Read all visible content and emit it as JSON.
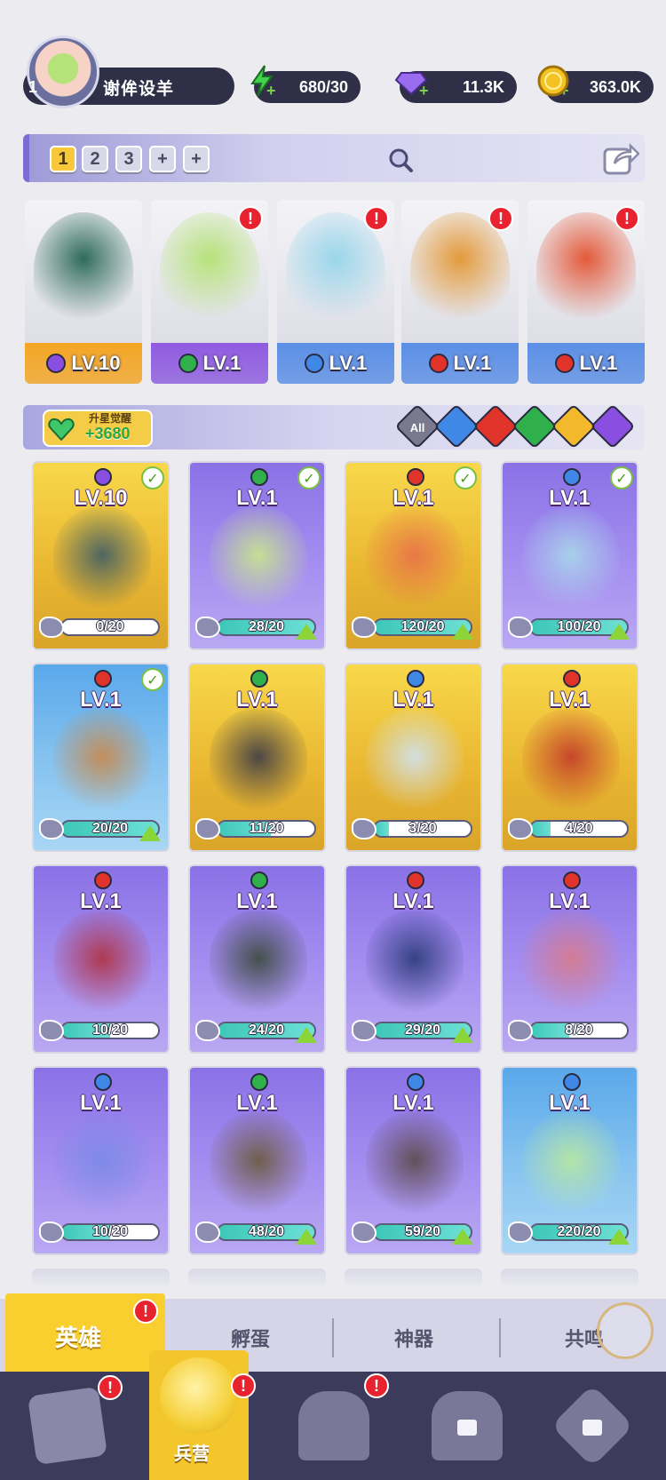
{
  "player": {
    "level": "1",
    "name": "谢侔设羊"
  },
  "resources": [
    {
      "name": "stamina",
      "value": "680/30",
      "icon": "lightning-icon",
      "color": "#3fd24a"
    },
    {
      "name": "gems",
      "value": "11.3K",
      "icon": "gem-icon",
      "color": "#9a6cf0"
    },
    {
      "name": "gold",
      "value": "363.0K",
      "icon": "coin-icon",
      "color": "#f4c322"
    }
  ],
  "team": {
    "slots": [
      "1",
      "2",
      "3",
      "+",
      "+"
    ],
    "active_slot": "1",
    "members": [
      {
        "level": "LV.10",
        "element": "dark",
        "bar_color": "#f4a623",
        "art": "#2f6b5a",
        "alert": false
      },
      {
        "level": "LV.1",
        "element": "wind",
        "bar_color": "#8f5be0",
        "art": "#b6e27a",
        "alert": true
      },
      {
        "level": "LV.1",
        "element": "water",
        "bar_color": "#5b8fe6",
        "art": "#9ad6ea",
        "alert": true
      },
      {
        "level": "LV.1",
        "element": "fire",
        "bar_color": "#5b8fe6",
        "art": "#e39a3a",
        "alert": true
      },
      {
        "level": "LV.1",
        "element": "fire",
        "bar_color": "#5b8fe6",
        "art": "#e35a3a",
        "alert": true
      }
    ]
  },
  "star_awaken": {
    "title": "升星觉醒",
    "value": "+3680"
  },
  "filters": [
    {
      "name": "all",
      "label": "All",
      "color": "#7a7a8e"
    },
    {
      "name": "water",
      "color": "#3f88e6"
    },
    {
      "name": "fire",
      "color": "#e0342a"
    },
    {
      "name": "wind",
      "color": "#2fb04a"
    },
    {
      "name": "light",
      "color": "#f2b92c"
    },
    {
      "name": "dark",
      "color": "#8a4fe0"
    }
  ],
  "element_colors": {
    "dark": "#8a4fe0",
    "wind": "#2fb04a",
    "water": "#3f88e6",
    "fire": "#e0342a",
    "light": "#f2b92c"
  },
  "heroes": [
    {
      "level": "LV.10",
      "element": "dark",
      "progress": "0/20",
      "fraction": 0.0,
      "rarity": "gold",
      "check": true,
      "upgrade": false,
      "art": "#3d5c66"
    },
    {
      "level": "LV.1",
      "element": "wind",
      "progress": "28/20",
      "fraction": 1.0,
      "rarity": "purple",
      "check": true,
      "upgrade": true,
      "art": "#c9e88a"
    },
    {
      "level": "LV.1",
      "element": "fire",
      "progress": "120/20",
      "fraction": 1.0,
      "rarity": "gold",
      "check": true,
      "upgrade": true,
      "art": "#e8704a"
    },
    {
      "level": "LV.1",
      "element": "water",
      "progress": "100/20",
      "fraction": 1.0,
      "rarity": "purple",
      "check": true,
      "upgrade": true,
      "art": "#a8d8ea"
    },
    {
      "level": "LV.1",
      "element": "fire",
      "progress": "20/20",
      "fraction": 1.0,
      "rarity": "blue",
      "check": true,
      "upgrade": true,
      "art": "#c8884a"
    },
    {
      "level": "LV.1",
      "element": "wind",
      "progress": "11/20",
      "fraction": 0.55,
      "rarity": "gold",
      "check": false,
      "upgrade": false,
      "art": "#3a3a48"
    },
    {
      "level": "LV.1",
      "element": "water",
      "progress": "3/20",
      "fraction": 0.15,
      "rarity": "gold",
      "check": false,
      "upgrade": false,
      "art": "#cfe2f2"
    },
    {
      "level": "LV.1",
      "element": "fire",
      "progress": "4/20",
      "fraction": 0.2,
      "rarity": "gold",
      "check": false,
      "upgrade": false,
      "art": "#c23a2a"
    },
    {
      "level": "LV.1",
      "element": "fire",
      "progress": "10/20",
      "fraction": 0.5,
      "rarity": "purple",
      "check": false,
      "upgrade": false,
      "art": "#b03040"
    },
    {
      "level": "LV.1",
      "element": "wind",
      "progress": "24/20",
      "fraction": 1.0,
      "rarity": "purple",
      "check": false,
      "upgrade": true,
      "art": "#3a4a3a"
    },
    {
      "level": "LV.1",
      "element": "fire",
      "progress": "29/20",
      "fraction": 1.0,
      "rarity": "purple",
      "check": false,
      "upgrade": true,
      "art": "#2a3a78"
    },
    {
      "level": "LV.1",
      "element": "fire",
      "progress": "8/20",
      "fraction": 0.4,
      "rarity": "purple",
      "check": false,
      "upgrade": false,
      "art": "#d87a8a"
    },
    {
      "level": "LV.1",
      "element": "water",
      "progress": "10/20",
      "fraction": 0.5,
      "rarity": "purple",
      "check": false,
      "upgrade": false,
      "art": "#7a8ae6"
    },
    {
      "level": "LV.1",
      "element": "wind",
      "progress": "48/20",
      "fraction": 1.0,
      "rarity": "purple",
      "check": false,
      "upgrade": true,
      "art": "#6a5a3a"
    },
    {
      "level": "LV.1",
      "element": "water",
      "progress": "59/20",
      "fraction": 1.0,
      "rarity": "purple",
      "check": false,
      "upgrade": true,
      "art": "#5a4a4a"
    },
    {
      "level": "LV.1",
      "element": "water",
      "progress": "220/20",
      "fraction": 1.0,
      "rarity": "blue",
      "check": false,
      "upgrade": true,
      "art": "#b8e8a0"
    }
  ],
  "sub_tabs": [
    {
      "label": "英雄",
      "active": true,
      "alert": true
    },
    {
      "label": "孵蛋",
      "active": false,
      "alert": false
    },
    {
      "label": "神器",
      "active": false,
      "alert": false
    },
    {
      "label": "共鸣",
      "active": false,
      "alert": false
    }
  ],
  "bottom_nav": [
    {
      "name": "cards",
      "icon": "cards-icon",
      "alert": true,
      "locked": false
    },
    {
      "name": "barracks",
      "label": "兵营",
      "icon": "fist-icon",
      "alert": true,
      "locked": false,
      "active": true
    },
    {
      "name": "map",
      "icon": "map-book-icon",
      "alert": true,
      "locked": false
    },
    {
      "name": "shop",
      "icon": "shop-lock-icon",
      "alert": false,
      "locked": true
    },
    {
      "name": "guild",
      "icon": "guild-lock-icon",
      "alert": false,
      "locked": true
    }
  ],
  "alert_glyph": "!"
}
